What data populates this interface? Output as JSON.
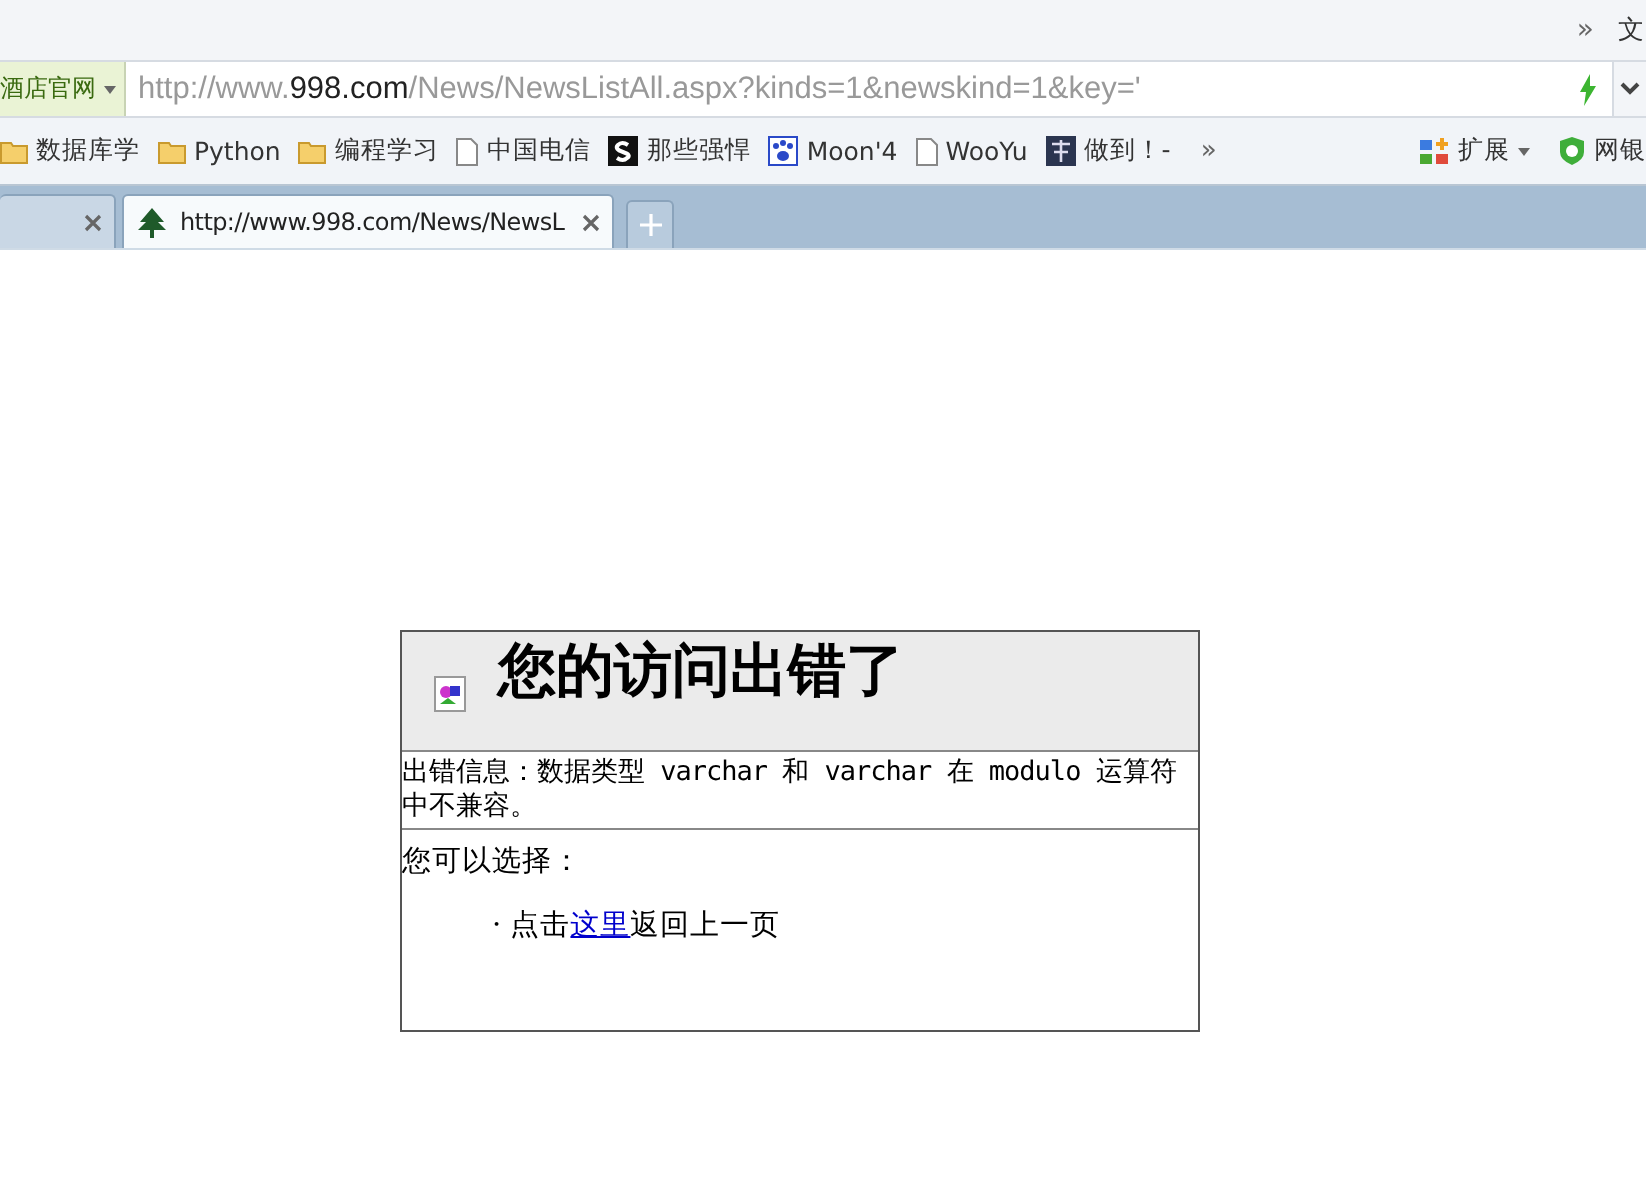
{
  "top_bar": {
    "more": "»",
    "menu": "文"
  },
  "address_bar": {
    "site_dropdown": "酒店官网",
    "url": "http://www.**998.com**/News/NewsListAll.aspx?kinds=1&newskind=1&key='"
  },
  "bookmarks": [
    {
      "kind": "folder",
      "label": "数据库学"
    },
    {
      "kind": "folder",
      "label": "Python"
    },
    {
      "kind": "folder",
      "label": "编程学习"
    },
    {
      "kind": "page",
      "label": "中国电信"
    },
    {
      "kind": "s-logo",
      "label": "那些强悍"
    },
    {
      "kind": "paw",
      "label": "Moon'4"
    },
    {
      "kind": "page",
      "label": "WooYu"
    },
    {
      "kind": "do-logo",
      "label": "做到！-"
    }
  ],
  "bookmarks_more": "»",
  "toolbar_right": [
    {
      "kind": "extensions",
      "label": "扩展"
    },
    {
      "kind": "shield",
      "label": "网银"
    }
  ],
  "tabs": [
    {
      "selected": false
    },
    {
      "title": "http://www.998.com/News/NewsL",
      "selected": true
    }
  ],
  "error_box": {
    "title": "您的访问出错了",
    "message": "出错信息：数据类型 varchar 和 varchar 在 modulo 运算符中不兼容。",
    "options_label": "您可以选择：",
    "option": {
      "bullet": "·",
      "before": "点击",
      "link": "这里",
      "after": "返回上一页"
    }
  }
}
